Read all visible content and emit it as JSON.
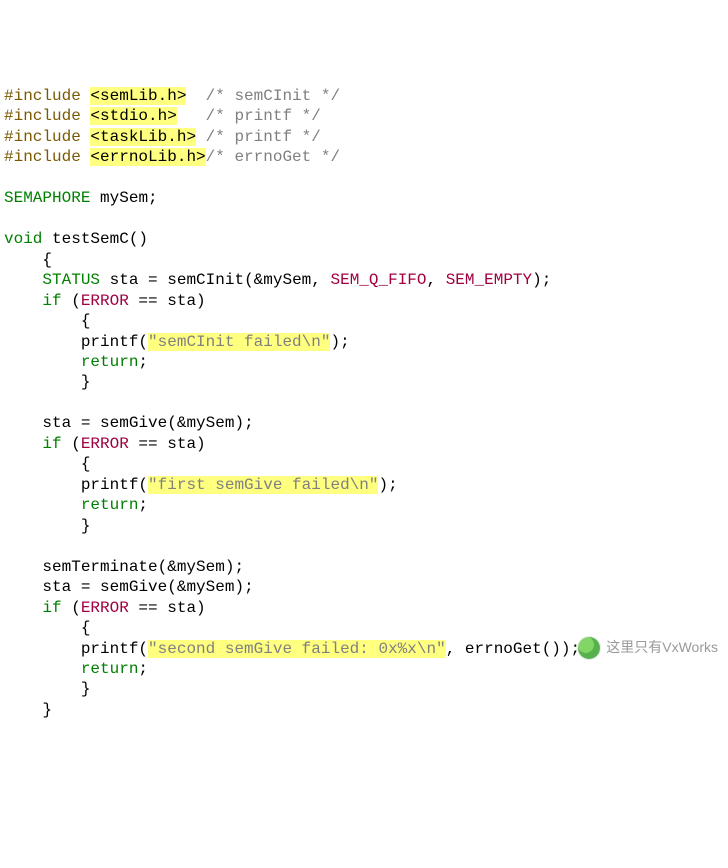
{
  "inc": {
    "pp": "#include",
    "h1": "<semLib.h>",
    "c1": "/* semCInit */",
    "h2": "<stdio.h>",
    "c2": "/* printf */",
    "h3": "<taskLib.h>",
    "c3": "/* printf */",
    "h4": "<errnoLib.h>",
    "c4": "/* errnoGet */"
  },
  "kw": {
    "SEMAPHORE": "SEMAPHORE",
    "STATUS": "STATUS",
    "void": "void",
    "if": "if",
    "return": "return"
  },
  "mac": {
    "ERROR": "ERROR",
    "SEM_Q_FIFO": "SEM_Q_FIFO",
    "SEM_EMPTY": "SEM_EMPTY"
  },
  "id": {
    "mySem": "mySem",
    "sta": "sta",
    "testSemC": "testSemC",
    "semCInit": "semCInit",
    "semGive": "semGive",
    "semTerminate": "semTerminate",
    "printf": "printf",
    "errnoGet": "errnoGet"
  },
  "str": {
    "s1": "\"semCInit failed\\n\"",
    "s2": "\"first semGive failed\\n\"",
    "s3": "\"second semGive failed: 0x%x\\n\""
  },
  "watermark": "这里只有VxWorks",
  "chart_data": null
}
